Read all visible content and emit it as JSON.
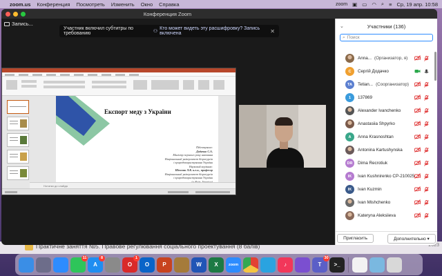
{
  "menubar": {
    "app_name": "zoom.us",
    "items": [
      "Конференция",
      "Посмотреть",
      "Изменить",
      "Окно",
      "Справка"
    ],
    "status_app": "zoom",
    "datetime": "Ср, 19 апр.  10:58"
  },
  "window": {
    "title": "Конференция Zoom",
    "recording_label": "Запись...",
    "subtitle_notice": "Участник включил субтитры по требованию",
    "subtitle_link": "Кто может видеть эту расшифровку? Запись включена"
  },
  "slide": {
    "title": "Експорт меду з України",
    "author_lines": [
      "Підготувала:",
      "Додачко С.А.",
      "Магістр першого року навчання",
      "Національний університет біоресурсів",
      "і природокористування України",
      "Науковий керівник:",
      "Шпиляк Л.К. к.е.н., професор",
      "Національний університет біоресурсів",
      "і природокористування України",
      "(м.Київ, Україна)"
    ],
    "notes_placeholder": "Нотатки до слайда"
  },
  "participants": {
    "header": "Участники (136)",
    "search_placeholder": "Поиск",
    "list": [
      {
        "name": "Anna...",
        "role": "(Организатор, я)",
        "initials": "",
        "color": "#8a6a4a",
        "photo": true,
        "video_off": true,
        "mic": "off"
      },
      {
        "name": "Сергій Додачко",
        "role": "",
        "initials": "С",
        "color": "#f0a030",
        "photo": false,
        "video_off": false,
        "mic": "on"
      },
      {
        "name": "Tetian...",
        "role": "(Соорганизатор)",
        "initials": "TA",
        "color": "#5b7fd0",
        "photo": false,
        "video_off": true,
        "mic": "off"
      },
      {
        "name": "137869",
        "role": "",
        "initials": "1",
        "color": "#3a9bdc",
        "photo": false,
        "video_off": true,
        "mic": "off"
      },
      {
        "name": "Alexander Ivanchenko",
        "role": "",
        "initials": "",
        "color": "#555",
        "photo": true,
        "video_off": true,
        "mic": "off"
      },
      {
        "name": "Anastasiia Shpyrko",
        "role": "",
        "initials": "",
        "color": "#7a5a4a",
        "photo": true,
        "video_off": true,
        "mic": "off"
      },
      {
        "name": "Anna Krasnoshtan",
        "role": "",
        "initials": "A",
        "color": "#3aa78a",
        "photo": false,
        "video_off": true,
        "mic": "off"
      },
      {
        "name": "Antonina Kartushynska",
        "role": "",
        "initials": "",
        "color": "#6a5a5a",
        "photo": true,
        "video_off": true,
        "mic": "off"
      },
      {
        "name": "Dima Recrotiuk",
        "role": "",
        "initials": "DR",
        "color": "#b57bd0",
        "photo": false,
        "video_off": true,
        "mic": "off"
      },
      {
        "name": "Ivan Kushnirenko CP-210025",
        "role": "",
        "initials": "IK",
        "color": "#b57bd0",
        "photo": false,
        "video_off": true,
        "mic": "off"
      },
      {
        "name": "Ivan Kuzmin",
        "role": "",
        "initials": "IK",
        "color": "#3a5a8a",
        "photo": false,
        "video_off": true,
        "mic": "off"
      },
      {
        "name": "Ivan Mishchenko",
        "role": "",
        "initials": "",
        "color": "#6a6a6a",
        "photo": true,
        "video_off": true,
        "mic": "off"
      },
      {
        "name": "Kateryna Aleksiieva",
        "role": "",
        "initials": "",
        "color": "#8a6a5a",
        "photo": true,
        "video_off": true,
        "mic": "off"
      }
    ],
    "invite_label": "Пригласить",
    "more_label": "Дополнительно ▾"
  },
  "desktop": {
    "file_label": "Практичне заняття №5. Правове регулювання соціального проектування (8 балів)",
    "corner_text": "2023"
  },
  "dock": {
    "apps": [
      {
        "name": "finder",
        "color": "#3a8ee6",
        "label": "",
        "badge": ""
      },
      {
        "name": "launchpad",
        "color": "#6d6d8a",
        "label": "",
        "badge": ""
      },
      {
        "name": "safari",
        "color": "#2d8cff",
        "label": "",
        "badge": ""
      },
      {
        "name": "facetime",
        "color": "#2ec55a",
        "label": "",
        "badge": "11"
      },
      {
        "name": "app-store",
        "color": "#1f8ef1",
        "label": "A",
        "badge": "8"
      },
      {
        "name": "settings",
        "color": "#8a8a8a",
        "label": "",
        "badge": ""
      },
      {
        "name": "opera",
        "color": "#d92a2a",
        "label": "O",
        "badge": "1"
      },
      {
        "name": "outlook",
        "color": "#0a64c8",
        "label": "O",
        "badge": ""
      },
      {
        "name": "powerpoint",
        "color": "#c8431f",
        "label": "P",
        "badge": ""
      },
      {
        "name": "preview",
        "color": "#a57b3a",
        "label": "",
        "badge": ""
      },
      {
        "name": "word",
        "color": "#2155b6",
        "label": "W",
        "badge": ""
      },
      {
        "name": "excel",
        "color": "#1d7a44",
        "label": "X",
        "badge": ""
      },
      {
        "name": "zoom",
        "color": "#2d8cff",
        "label": "zoom",
        "badge": ""
      },
      {
        "name": "chrome",
        "color": "#e8e8e8",
        "label": "",
        "badge": ""
      },
      {
        "name": "telegram",
        "color": "#2aa3e0",
        "label": "",
        "badge": ""
      },
      {
        "name": "music",
        "color": "#f2375a",
        "label": "♪",
        "badge": ""
      },
      {
        "name": "viber",
        "color": "#7b4fd0",
        "label": "",
        "badge": ""
      },
      {
        "name": "teams",
        "color": "#5b5fc7",
        "label": "T",
        "badge": "30"
      },
      {
        "name": "terminal",
        "color": "#222222",
        "label": ">_",
        "badge": ""
      },
      {
        "name": "document",
        "color": "#f2f2f2",
        "label": "",
        "badge": ""
      },
      {
        "name": "image-file",
        "color": "#7ab8e0",
        "label": "",
        "badge": ""
      },
      {
        "name": "trash",
        "color": "#d8d8d8",
        "label": "",
        "badge": ""
      }
    ]
  }
}
